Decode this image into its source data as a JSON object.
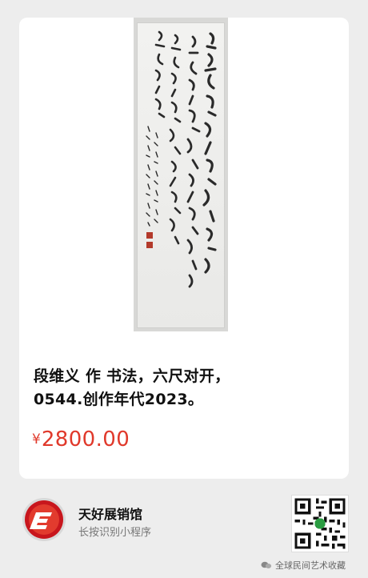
{
  "product": {
    "title": "段维义 作 书法，六尺对开，\n0544.创作年代2023。",
    "price_symbol": "¥",
    "price_value": "2800.00",
    "accent_color": "#e0392b"
  },
  "shop": {
    "name": "天好展销馆",
    "subtitle": "长按识别小程序",
    "logo_icon": "red-e-logo-icon",
    "qr_icon": "mini-program-qr-icon"
  },
  "watermark": {
    "text": "全球民间艺术收藏",
    "icon": "wechat-chat-icon"
  }
}
